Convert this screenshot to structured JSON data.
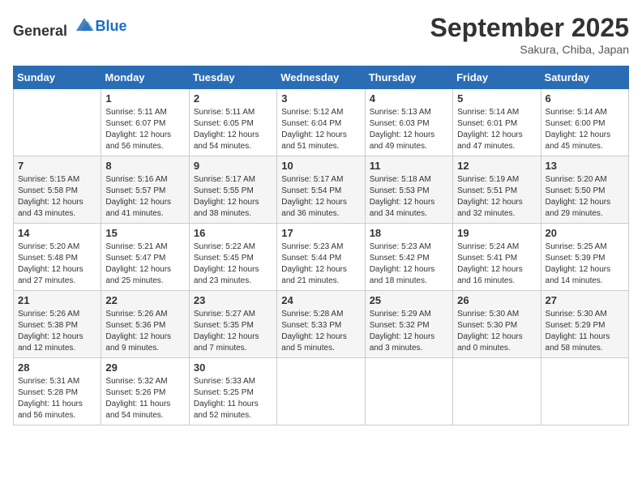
{
  "header": {
    "logo_general": "General",
    "logo_blue": "Blue",
    "month": "September 2025",
    "location": "Sakura, Chiba, Japan"
  },
  "weekdays": [
    "Sunday",
    "Monday",
    "Tuesday",
    "Wednesday",
    "Thursday",
    "Friday",
    "Saturday"
  ],
  "weeks": [
    [
      {
        "day": "",
        "info": ""
      },
      {
        "day": "1",
        "info": "Sunrise: 5:11 AM\nSunset: 6:07 PM\nDaylight: 12 hours\nand 56 minutes."
      },
      {
        "day": "2",
        "info": "Sunrise: 5:11 AM\nSunset: 6:05 PM\nDaylight: 12 hours\nand 54 minutes."
      },
      {
        "day": "3",
        "info": "Sunrise: 5:12 AM\nSunset: 6:04 PM\nDaylight: 12 hours\nand 51 minutes."
      },
      {
        "day": "4",
        "info": "Sunrise: 5:13 AM\nSunset: 6:03 PM\nDaylight: 12 hours\nand 49 minutes."
      },
      {
        "day": "5",
        "info": "Sunrise: 5:14 AM\nSunset: 6:01 PM\nDaylight: 12 hours\nand 47 minutes."
      },
      {
        "day": "6",
        "info": "Sunrise: 5:14 AM\nSunset: 6:00 PM\nDaylight: 12 hours\nand 45 minutes."
      }
    ],
    [
      {
        "day": "7",
        "info": "Sunrise: 5:15 AM\nSunset: 5:58 PM\nDaylight: 12 hours\nand 43 minutes."
      },
      {
        "day": "8",
        "info": "Sunrise: 5:16 AM\nSunset: 5:57 PM\nDaylight: 12 hours\nand 41 minutes."
      },
      {
        "day": "9",
        "info": "Sunrise: 5:17 AM\nSunset: 5:55 PM\nDaylight: 12 hours\nand 38 minutes."
      },
      {
        "day": "10",
        "info": "Sunrise: 5:17 AM\nSunset: 5:54 PM\nDaylight: 12 hours\nand 36 minutes."
      },
      {
        "day": "11",
        "info": "Sunrise: 5:18 AM\nSunset: 5:53 PM\nDaylight: 12 hours\nand 34 minutes."
      },
      {
        "day": "12",
        "info": "Sunrise: 5:19 AM\nSunset: 5:51 PM\nDaylight: 12 hours\nand 32 minutes."
      },
      {
        "day": "13",
        "info": "Sunrise: 5:20 AM\nSunset: 5:50 PM\nDaylight: 12 hours\nand 29 minutes."
      }
    ],
    [
      {
        "day": "14",
        "info": "Sunrise: 5:20 AM\nSunset: 5:48 PM\nDaylight: 12 hours\nand 27 minutes."
      },
      {
        "day": "15",
        "info": "Sunrise: 5:21 AM\nSunset: 5:47 PM\nDaylight: 12 hours\nand 25 minutes."
      },
      {
        "day": "16",
        "info": "Sunrise: 5:22 AM\nSunset: 5:45 PM\nDaylight: 12 hours\nand 23 minutes."
      },
      {
        "day": "17",
        "info": "Sunrise: 5:23 AM\nSunset: 5:44 PM\nDaylight: 12 hours\nand 21 minutes."
      },
      {
        "day": "18",
        "info": "Sunrise: 5:23 AM\nSunset: 5:42 PM\nDaylight: 12 hours\nand 18 minutes."
      },
      {
        "day": "19",
        "info": "Sunrise: 5:24 AM\nSunset: 5:41 PM\nDaylight: 12 hours\nand 16 minutes."
      },
      {
        "day": "20",
        "info": "Sunrise: 5:25 AM\nSunset: 5:39 PM\nDaylight: 12 hours\nand 14 minutes."
      }
    ],
    [
      {
        "day": "21",
        "info": "Sunrise: 5:26 AM\nSunset: 5:38 PM\nDaylight: 12 hours\nand 12 minutes."
      },
      {
        "day": "22",
        "info": "Sunrise: 5:26 AM\nSunset: 5:36 PM\nDaylight: 12 hours\nand 9 minutes."
      },
      {
        "day": "23",
        "info": "Sunrise: 5:27 AM\nSunset: 5:35 PM\nDaylight: 12 hours\nand 7 minutes."
      },
      {
        "day": "24",
        "info": "Sunrise: 5:28 AM\nSunset: 5:33 PM\nDaylight: 12 hours\nand 5 minutes."
      },
      {
        "day": "25",
        "info": "Sunrise: 5:29 AM\nSunset: 5:32 PM\nDaylight: 12 hours\nand 3 minutes."
      },
      {
        "day": "26",
        "info": "Sunrise: 5:30 AM\nSunset: 5:30 PM\nDaylight: 12 hours\nand 0 minutes."
      },
      {
        "day": "27",
        "info": "Sunrise: 5:30 AM\nSunset: 5:29 PM\nDaylight: 11 hours\nand 58 minutes."
      }
    ],
    [
      {
        "day": "28",
        "info": "Sunrise: 5:31 AM\nSunset: 5:28 PM\nDaylight: 11 hours\nand 56 minutes."
      },
      {
        "day": "29",
        "info": "Sunrise: 5:32 AM\nSunset: 5:26 PM\nDaylight: 11 hours\nand 54 minutes."
      },
      {
        "day": "30",
        "info": "Sunrise: 5:33 AM\nSunset: 5:25 PM\nDaylight: 11 hours\nand 52 minutes."
      },
      {
        "day": "",
        "info": ""
      },
      {
        "day": "",
        "info": ""
      },
      {
        "day": "",
        "info": ""
      },
      {
        "day": "",
        "info": ""
      }
    ]
  ]
}
